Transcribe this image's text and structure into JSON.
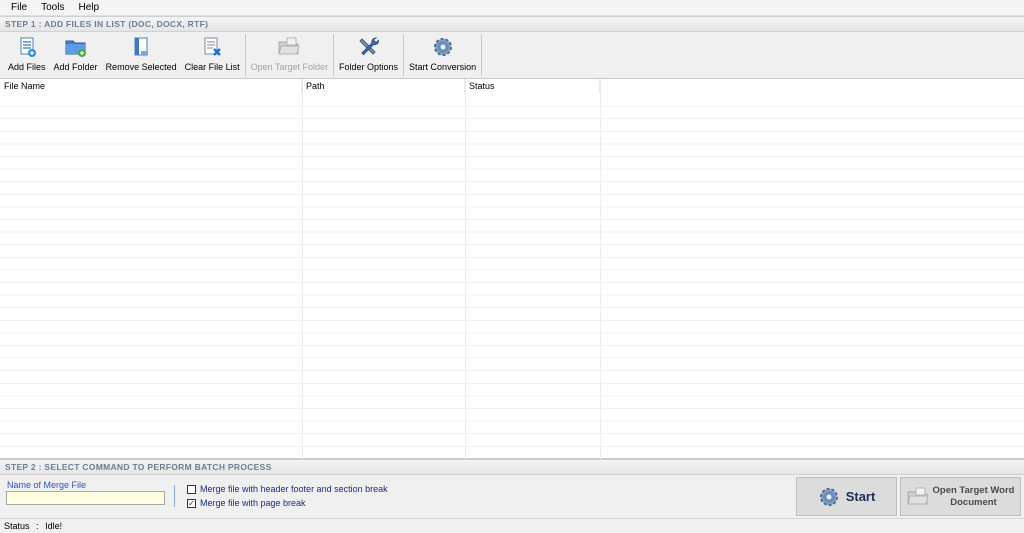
{
  "menu": [
    "File",
    "Tools",
    "Help"
  ],
  "step1": {
    "title": "STEP 1 : ADD FILES IN LIST (DOC, DOCX, RTF)"
  },
  "toolbar": {
    "add_files": "Add Files",
    "add_folder": "Add Folder",
    "remove_selected": "Remove Selected",
    "clear_file_list": "Clear File List",
    "open_target_folder": "Open Target Folder",
    "folder_options": "Folder Options",
    "start_conversion": "Start Conversion"
  },
  "table": {
    "columns": [
      "File Name",
      "Path",
      "Status"
    ],
    "rows": []
  },
  "step2": {
    "title": "STEP 2 : SELECT COMMAND TO PERFORM BATCH PROCESS",
    "merge_name_label": "Name of Merge File",
    "merge_name_value": "",
    "option_header_footer": {
      "label": "Merge file with header footer and section break",
      "checked": false
    },
    "option_page_break": {
      "label": "Merge file with page break",
      "checked": true
    },
    "start_label": "Start",
    "open_target_line1": "Open Target Word",
    "open_target_line2": "Document"
  },
  "status": {
    "label": "Status",
    "separator": ":",
    "value": "Idle!"
  },
  "colors": {
    "step_header_text": "#6d7d93",
    "merge_label": "#2255cc",
    "option_text": "#1a2a8a",
    "input_bg": "#ffffe0"
  }
}
